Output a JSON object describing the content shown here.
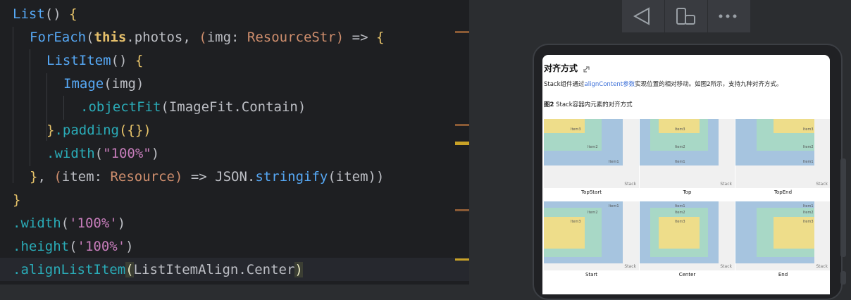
{
  "editor": {
    "lines": [
      {
        "indent": 0,
        "tokens": [
          {
            "t": "List",
            "c": "c-comp"
          },
          {
            "t": "() ",
            "c": "c-white"
          },
          {
            "t": "{",
            "c": "c-yellow"
          }
        ]
      },
      {
        "indent": 1,
        "tokens": [
          {
            "t": "ForEach",
            "c": "c-comp"
          },
          {
            "t": "(",
            "c": "c-white"
          },
          {
            "t": "this",
            "c": "c-boldw"
          },
          {
            "t": ".photos, ",
            "c": "c-white"
          },
          {
            "t": "(",
            "c": "c-orange"
          },
          {
            "t": "img",
            "c": "c-white"
          },
          {
            "t": ": ",
            "c": "c-white"
          },
          {
            "t": "ResourceStr",
            "c": "c-orange"
          },
          {
            "t": ") ",
            "c": "c-orange"
          },
          {
            "t": "=> ",
            "c": "c-white"
          },
          {
            "t": "{",
            "c": "c-yellow"
          }
        ]
      },
      {
        "indent": 2,
        "tokens": [
          {
            "t": "ListItem",
            "c": "c-comp"
          },
          {
            "t": "() ",
            "c": "c-white"
          },
          {
            "t": "{",
            "c": "c-yellow"
          }
        ]
      },
      {
        "indent": 3,
        "tokens": [
          {
            "t": "Image",
            "c": "c-comp"
          },
          {
            "t": "(img)",
            "c": "c-white"
          }
        ]
      },
      {
        "indent": 4,
        "tokens": [
          {
            "t": ".objectFit",
            "c": "c-teal"
          },
          {
            "t": "(ImageFit.Contain)",
            "c": "c-white"
          }
        ]
      },
      {
        "indent": 2,
        "tokens": [
          {
            "t": "}",
            "c": "c-yellow"
          },
          {
            "t": ".padding",
            "c": "c-teal"
          },
          {
            "t": "({})",
            "c": "c-yellow"
          }
        ]
      },
      {
        "indent": 2,
        "tokens": [
          {
            "t": ".width",
            "c": "c-teal"
          },
          {
            "t": "(",
            "c": "c-white"
          },
          {
            "t": "\"100%\"",
            "c": "c-str"
          },
          {
            "t": ")",
            "c": "c-white"
          }
        ]
      },
      {
        "indent": 1,
        "tokens": [
          {
            "t": "}",
            "c": "c-yellow"
          },
          {
            "t": ", ",
            "c": "c-white"
          },
          {
            "t": "(",
            "c": "c-orange"
          },
          {
            "t": "item",
            "c": "c-white"
          },
          {
            "t": ": ",
            "c": "c-white"
          },
          {
            "t": "Resource",
            "c": "c-orange"
          },
          {
            "t": ") ",
            "c": "c-orange"
          },
          {
            "t": "=> JSON.",
            "c": "c-white"
          },
          {
            "t": "stringify",
            "c": "c-blue"
          },
          {
            "t": "(item))",
            "c": "c-white"
          }
        ]
      },
      {
        "indent": 0,
        "tokens": [
          {
            "t": "}",
            "c": "c-yellow"
          }
        ]
      },
      {
        "indent": 0,
        "tokens": [
          {
            "t": ".width",
            "c": "c-teal"
          },
          {
            "t": "(",
            "c": "c-white"
          },
          {
            "t": "'100%'",
            "c": "c-str"
          },
          {
            "t": ")",
            "c": "c-white"
          }
        ]
      },
      {
        "indent": 0,
        "tokens": [
          {
            "t": ".height",
            "c": "c-teal"
          },
          {
            "t": "(",
            "c": "c-white"
          },
          {
            "t": "'100%'",
            "c": "c-str"
          },
          {
            "t": ")",
            "c": "c-white"
          }
        ]
      },
      {
        "indent": 0,
        "tokens": [
          {
            "t": ".alignListItem",
            "c": "c-teal"
          },
          {
            "t": "(",
            "c": "c-hl"
          },
          {
            "t": "ListItemAlign.Center",
            "c": "c-white"
          },
          {
            "t": ")",
            "c": "c-hl"
          }
        ]
      }
    ]
  },
  "toolbar": {
    "back_icon": "triangle-back-icon",
    "device_icon": "device-rotate-icon",
    "more_icon": "more-icon"
  },
  "doc": {
    "title": "对齐方式",
    "para_before": "Stack组件通过",
    "para_link": "alignContent参数",
    "para_after": "实现位置的相对移动。如图2所示，支持九种对齐方式。",
    "caption_bold": "图2",
    "caption_rest": " Stack容器内元素的对齐方式",
    "cells": [
      {
        "label": "TopStart",
        "align": "TopStart"
      },
      {
        "label": "Top",
        "align": "Top"
      },
      {
        "label": "TopEnd",
        "align": "TopEnd"
      },
      {
        "label": "Start",
        "align": "Start"
      },
      {
        "label": "Center",
        "align": "Center"
      },
      {
        "label": "End",
        "align": "End"
      }
    ],
    "item1": "Item1",
    "item2": "Item2",
    "item3": "Item3",
    "stack": "Stack"
  },
  "colors": {
    "blue": "#a6c4df",
    "green": "#a8d8c6",
    "yellow": "#eedd8a"
  }
}
